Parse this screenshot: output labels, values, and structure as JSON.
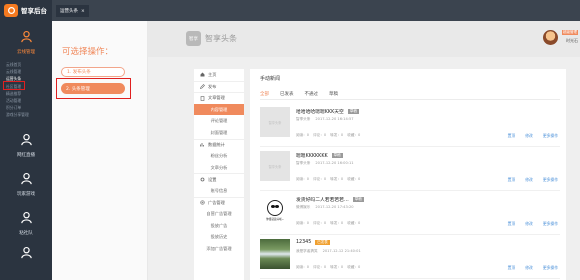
{
  "sidebar": {
    "logo_text": "智享后台",
    "nav": [
      {
        "label": "云线管理"
      },
      {
        "label": "网红直播"
      },
      {
        "label": "玩家游戏"
      },
      {
        "label": "粘社队"
      },
      {
        "label": ""
      }
    ],
    "subnav": [
      "云线首页",
      "云线管理",
      "运营头条",
      "社区管理",
      "精选推荐",
      "活动管理",
      "积分订单",
      "游戏分享管理"
    ]
  },
  "topbar": {
    "tab_label": "运营头条",
    "tab_close": "×"
  },
  "steps": {
    "title": "可选择操作：",
    "step1": "1. 发布头条",
    "step2": "2. 头条管理"
  },
  "brand": {
    "logo": "智享",
    "name": "智享头条"
  },
  "user": {
    "badge": "超级管理",
    "name": "时光石"
  },
  "menu": [
    {
      "label": "主页",
      "icon": "home-icon",
      "type": "head"
    },
    {
      "label": "发布",
      "icon": "edit-icon",
      "type": "head"
    },
    {
      "label": "文章管理",
      "icon": "doc-icon",
      "type": "head"
    },
    {
      "label": "内容管理",
      "type": "sub",
      "active": true
    },
    {
      "label": "评论管理",
      "type": "sub"
    },
    {
      "label": "封面管理",
      "type": "sub"
    },
    {
      "label": "数据统计",
      "icon": "chart-icon",
      "type": "head"
    },
    {
      "label": "粉丝分析",
      "type": "sub"
    },
    {
      "label": "文章分析",
      "type": "sub"
    },
    {
      "label": "设置",
      "icon": "gear-icon",
      "type": "head"
    },
    {
      "label": "账号信息",
      "type": "sub"
    },
    {
      "label": "广告管理",
      "icon": "ad-icon",
      "type": "head"
    },
    {
      "label": "自营广告管理",
      "type": "sub"
    },
    {
      "label": "投放广告",
      "type": "sub"
    },
    {
      "label": "投放历史",
      "type": "sub"
    },
    {
      "label": "添加广告管理",
      "type": "sub"
    }
  ],
  "content": {
    "title": "手动新闻",
    "tabs": [
      "全部",
      "已发表",
      "不通过",
      "草稿"
    ],
    "active_tab": 0,
    "thumb_placeholder": "智享头条",
    "meme_caption": "你懂就是好啦~",
    "actions": [
      "置顶",
      "修改",
      "更多操作"
    ],
    "rows": [
      {
        "title": "哈哈哈哈嗯嗯KKK天空",
        "badge": "草稿",
        "badge_color": "gray",
        "author": "智享头条",
        "time": "2017-12-20 16:14:57",
        "stats": [
          "阅读：0",
          "评论：0",
          "转发：0",
          "收藏：0"
        ],
        "thumb": "placeholder"
      },
      {
        "title": "嗯嗯KKKKKKK",
        "badge": "草稿",
        "badge_color": "gray",
        "author": "智享头条",
        "time": "2017-12-20 16:00:11",
        "stats": [
          "阅读：0",
          "评论：0",
          "转发：0",
          "收藏：0"
        ],
        "thumb": "placeholder"
      },
      {
        "title": "发货好吗二人若若若若…",
        "badge": "草稿",
        "badge_color": "gray",
        "author": "微博娱乐",
        "time": "2017-12-20 17:43:20",
        "stats": [
          "阅读：0",
          "评论：0",
          "转发：0",
          "收藏：0"
        ],
        "thumb": "meme"
      },
      {
        "title": "12345",
        "badge": "已发表",
        "badge_color": "orange",
        "author": "我是学者搞笑",
        "time": "2017-12-12 21:40:01",
        "stats": [
          "阅读：0",
          "评论：0",
          "转发：0",
          "收藏：0"
        ],
        "thumb": "water"
      }
    ]
  },
  "colors": {
    "accent": "#f08a5d",
    "sidebar": "#2b3440",
    "link": "#4a90d9",
    "highlight_box": "#e02020"
  }
}
